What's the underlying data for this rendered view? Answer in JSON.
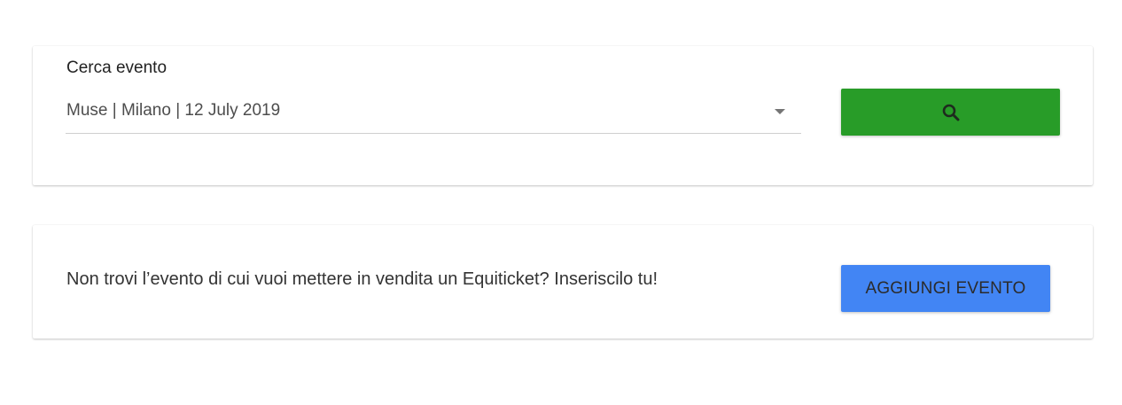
{
  "search_card": {
    "label": "Cerca evento",
    "selected_event": "Muse | Milano | 12 July 2019",
    "search_icon": "search-icon",
    "search_button_color": "#289c28"
  },
  "add_card": {
    "prompt": "Non trovi l’evento di cui vuoi mettere in vendita un Equiticket? Inseriscilo tu!",
    "add_button_label": "AGGIUNGI EVENTO",
    "add_button_color": "#4285f4"
  }
}
